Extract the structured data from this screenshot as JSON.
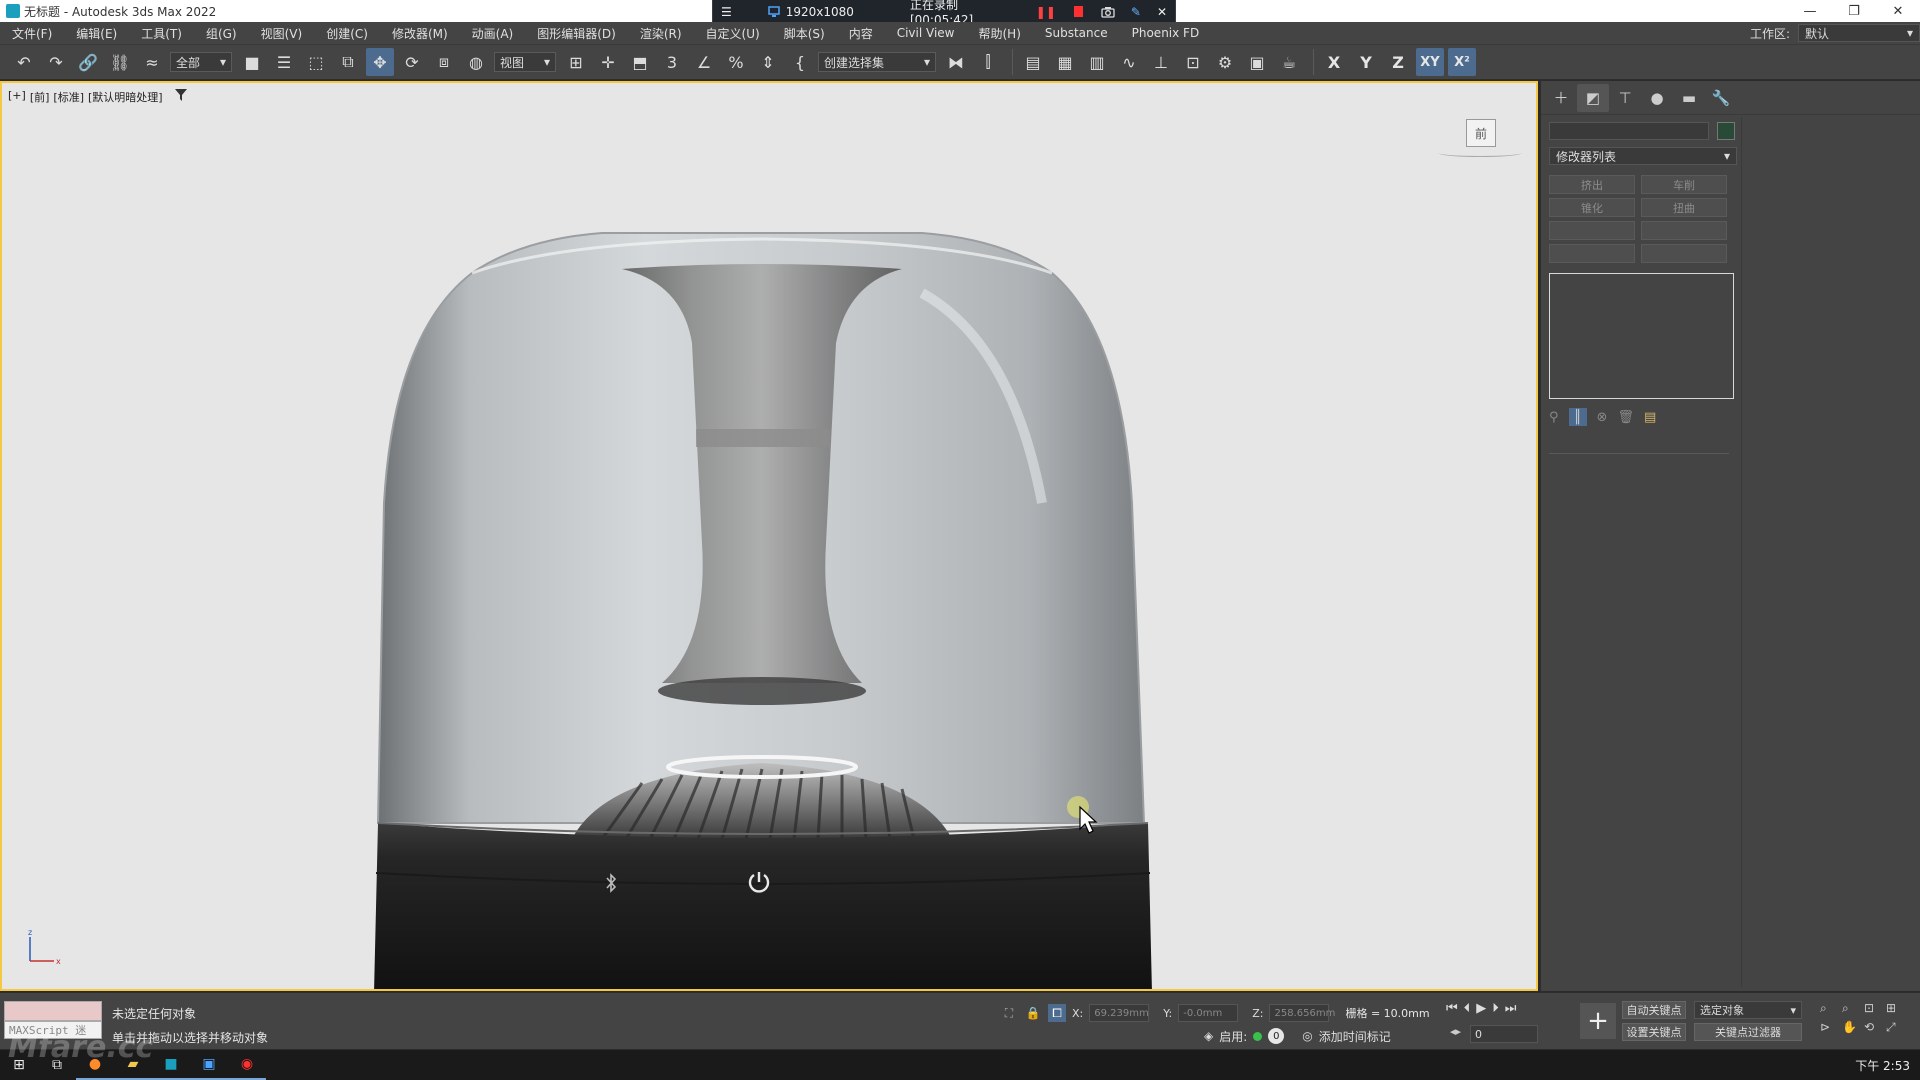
{
  "window": {
    "title": "无标题 - Autodesk 3ds Max 2022",
    "controls": [
      "—",
      "❐",
      "✕"
    ]
  },
  "recorder": {
    "menu_glyph": "☰",
    "resolution": "1920x1080",
    "status": "正在录制 [00:05:42]"
  },
  "menu": {
    "items": [
      "文件(F)",
      "编辑(E)",
      "工具(T)",
      "组(G)",
      "视图(V)",
      "创建(C)",
      "修改器(M)",
      "动画(A)",
      "图形编辑器(D)",
      "渲染(R)",
      "自定义(U)",
      "脚本(S)",
      "内容",
      "Civil View",
      "帮助(H)",
      "Substance",
      "Phoenix FD"
    ],
    "workspace_label": "工作区:",
    "workspace_value": "默认"
  },
  "toolbar": {
    "selection_filter": "全部",
    "ref_coord": "视图",
    "named_selection": "创建选择集",
    "axis_x": "X",
    "axis_y": "Y",
    "axis_z": "Z",
    "axis_xy": "XY",
    "axis_xz": "X²"
  },
  "viewport": {
    "labels": [
      "[+]",
      "[前]",
      "[标准]",
      "[默认明暗处理]"
    ],
    "viewcube_face": "前",
    "colors": {
      "background": "#e6e6e6",
      "active_border": "#f5c842"
    }
  },
  "command_panel": {
    "modifier_list": "修改器列表",
    "modifier_buttons": [
      "挤出",
      "车削",
      "锥化",
      "扭曲",
      "",
      "",
      "",
      ""
    ]
  },
  "status": {
    "maxscript_label": "MAXScript 迷",
    "line1": "未选定任何对象",
    "line2": "单击并拖动以选择并移动对象",
    "x_label": "X:",
    "x_value": "69.239mm",
    "y_label": "Y:",
    "y_value": "-0.0mm",
    "z_label": "Z:",
    "z_value": "258.656mm",
    "grid": "栅格 = 10.0mm",
    "enable_label": "启用:",
    "frame_badge": "0",
    "add_time_tag": "添加时间标记",
    "frame_value": "0",
    "auto_key": "自动关键点",
    "set_key": "设置关键点",
    "selected_object": "选定对象",
    "key_filters": "关键点过滤器"
  },
  "taskbar": {
    "clock": "下午 2:53"
  },
  "watermark": "Mfare.cc"
}
